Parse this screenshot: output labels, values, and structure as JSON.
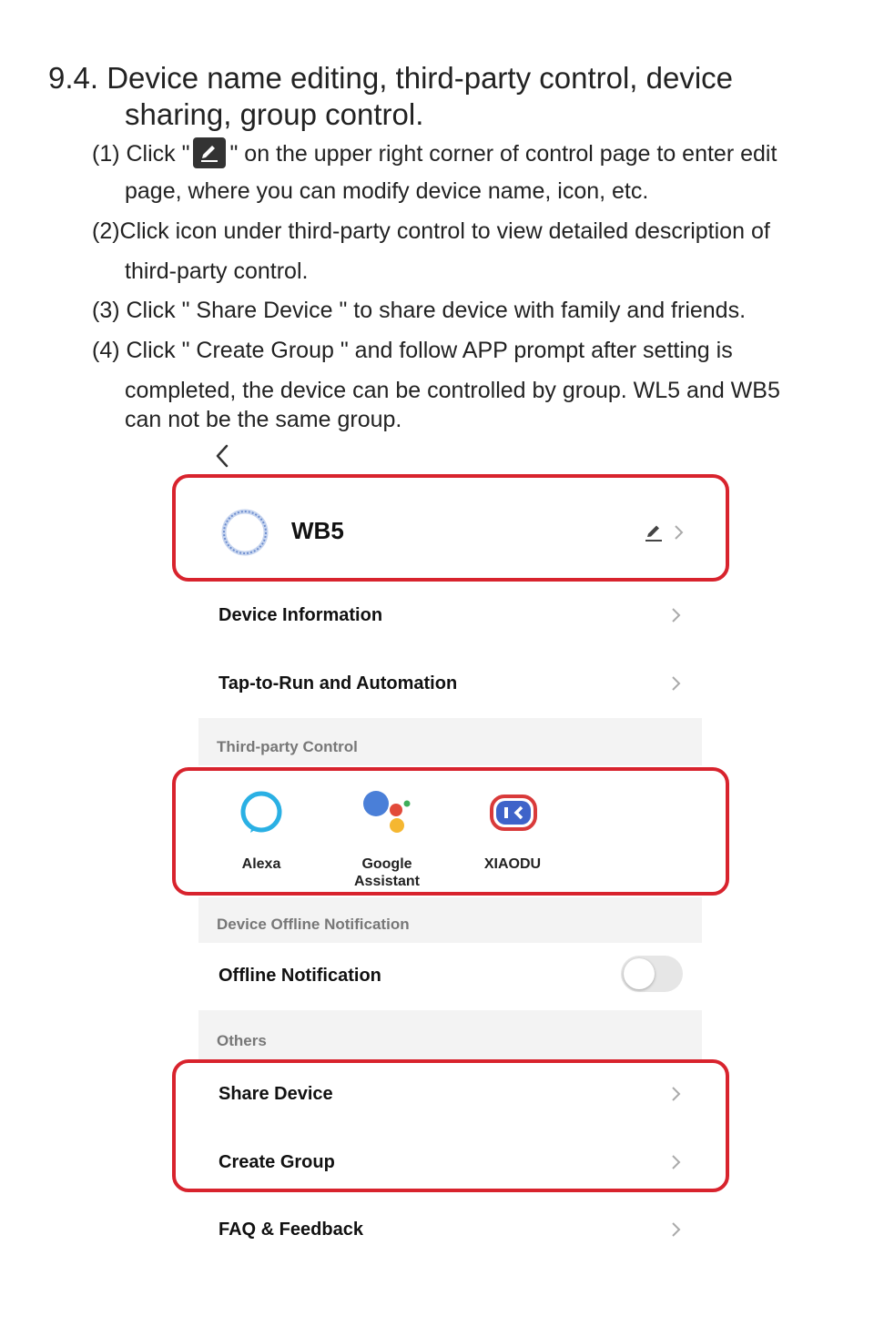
{
  "doc": {
    "heading_line1": "9.4. Device name editing, third-party control, device",
    "heading_line2": "sharing, group control.",
    "step1_a": "(1) Click \"",
    "step1_b": "\" on the upper right corner of control page to enter edit",
    "step1_cont": "page, where you can modify device name, icon, etc.",
    "step2_a": "(2)Click icon under third-party control to view detailed description of",
    "step2_cont": "third-party control.",
    "step3": "(3) Click \" Share Device \" to share device with family and friends.",
    "step4_a": "(4) Click \" Create Group \" and follow APP prompt after setting is",
    "step4_cont1": "completed, the device can be controlled by group. WL5 and WB5",
    "step4_cont2": "can not be the same group."
  },
  "screen": {
    "device_name": "WB5",
    "rows": {
      "device_info": "Device Information",
      "tap_to_run": "Tap-to-Run and Automation",
      "offline_notification": "Offline Notification",
      "share_device": "Share Device",
      "create_group": "Create Group",
      "faq": "FAQ & Feedback"
    },
    "sections": {
      "third_party": "Third-party Control",
      "offline": "Device Offline Notification",
      "others": "Others"
    },
    "third_party_items": [
      {
        "label": "Alexa",
        "icon": "alexa-icon"
      },
      {
        "label": "Google Assistant",
        "label_line1": "Google",
        "label_line2": "Assistant",
        "icon": "google-assistant-icon"
      },
      {
        "label": "XIAODU",
        "icon": "xiaodu-icon"
      }
    ],
    "offline_toggle_on": false,
    "highlight_color": "#d8232d"
  }
}
